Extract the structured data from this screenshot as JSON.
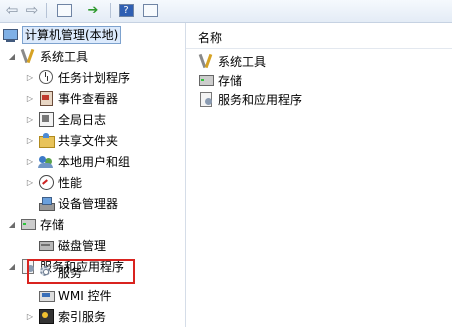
{
  "toolbar": {
    "buttons": [
      "back-icon",
      "forward-icon",
      "show-hide-tree-icon",
      "export-list-icon",
      "help-icon",
      "properties-icon"
    ]
  },
  "tree": {
    "root": "计算机管理(本地)",
    "system_tools": "系统工具",
    "task_scheduler": "任务计划程序",
    "event_viewer": "事件查看器",
    "global_log": "全局日志",
    "shared_folders": "共享文件夹",
    "local_users": "本地用户和组",
    "performance": "性能",
    "device_manager": "设备管理器",
    "storage": "存储",
    "disk_management": "磁盘管理",
    "services_apps": "服务和应用程序",
    "services": "服务",
    "wmi": "WMI 控件",
    "indexing": "索引服务"
  },
  "list": {
    "column_name": "名称",
    "items": [
      "系统工具",
      "存储",
      "服务和应用程序"
    ]
  },
  "colors": {
    "highlight_border": "#d9231f",
    "selection_bg": "#dceafc"
  }
}
